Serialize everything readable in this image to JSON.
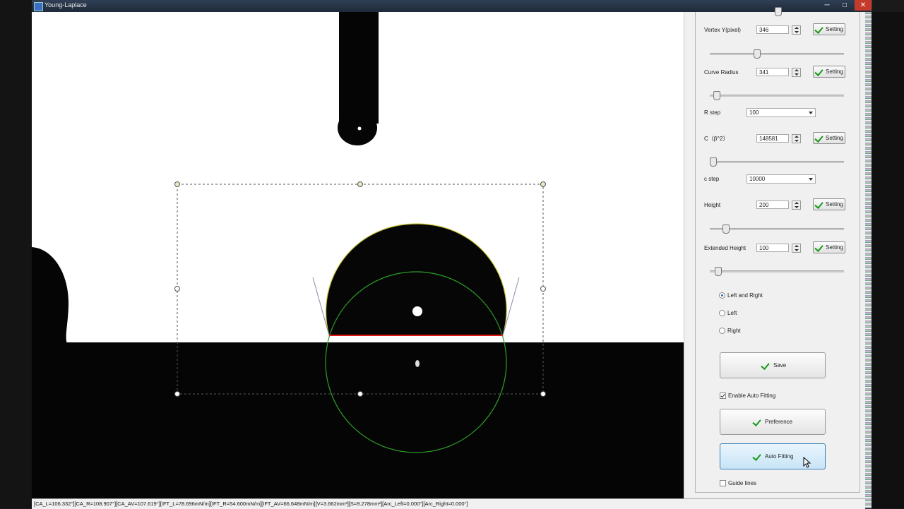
{
  "window": {
    "title": "Young-Laplace",
    "minimize": "─",
    "maximize": "□",
    "close": "✕"
  },
  "panel": {
    "vertex_y": {
      "label": "Vertex Y(pixel)",
      "value": "346",
      "button": "Setting",
      "slider": 0.34
    },
    "curve_radius": {
      "label": "Curve Radius",
      "value": "341",
      "button": "Setting",
      "slider": 0.03
    },
    "r_step": {
      "label": "R step",
      "value": "100"
    },
    "c": {
      "label": "C（β^2）",
      "value": "148581",
      "button": "Setting",
      "slider": 0.0
    },
    "c_step": {
      "label": "c step",
      "value": "10000"
    },
    "height": {
      "label": "Height",
      "value": "200",
      "button": "Setting",
      "slider": 0.1
    },
    "extended_height": {
      "label": "Extended Height",
      "value": "100",
      "button": "Setting",
      "slider": 0.04
    },
    "side": {
      "options": [
        "Left and Right",
        "Left",
        "Right"
      ],
      "selected": 0
    },
    "save": "Save",
    "enable_auto_fitting": {
      "label": "Enable Auto Fitting",
      "checked": true
    },
    "preference": "Preference",
    "auto_fitting": "Auto Fitting",
    "guide_lines": {
      "label": "Guide lines",
      "checked": false
    }
  },
  "status": "[CA_L=106.332°][CA_R=108.907°][CA_AV=107.619°][IFT_L=78.696mN/m][IFT_R=54.600mN/m][IFT_AV=66.648mN/m][V=3.662mm³][S=9.278mm²][Arc_Left=0.000°][Arc_Right=0.000°]",
  "colors": {
    "fit_curve": "#3ba82a",
    "baseline": "#e01818",
    "accent": "#1a9a1a"
  }
}
